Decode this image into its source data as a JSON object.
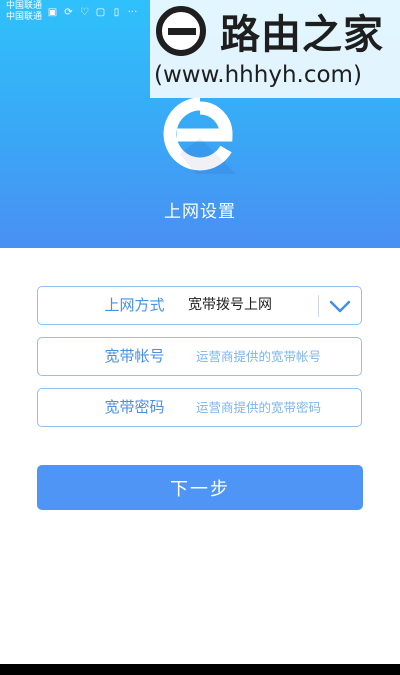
{
  "status_bar": {
    "carrier_1": "中国联通",
    "carrier_2": "中国联通",
    "icons": [
      "signal-icon",
      "sync-icon",
      "heart-icon",
      "photo-icon",
      "sim-icon"
    ],
    "more": "···"
  },
  "watermark": {
    "site_name": "路由之家",
    "url": "(www.hhhyh.com)"
  },
  "header": {
    "title": "上网设置"
  },
  "form": {
    "connection_type": {
      "label": "上网方式",
      "value": "宽带拨号上网"
    },
    "account": {
      "label": "宽带帐号",
      "placeholder": "运营商提供的宽带帐号"
    },
    "password": {
      "label": "宽带密码",
      "placeholder": "运营商提供的宽带密码"
    }
  },
  "actions": {
    "next_label": "下一步"
  },
  "colors": {
    "header_top": "#2fc1fb",
    "header_bottom": "#4a8ff3",
    "accent": "#4a90e2",
    "button": "#4e95f5",
    "field_border": "#8ec1f2"
  }
}
